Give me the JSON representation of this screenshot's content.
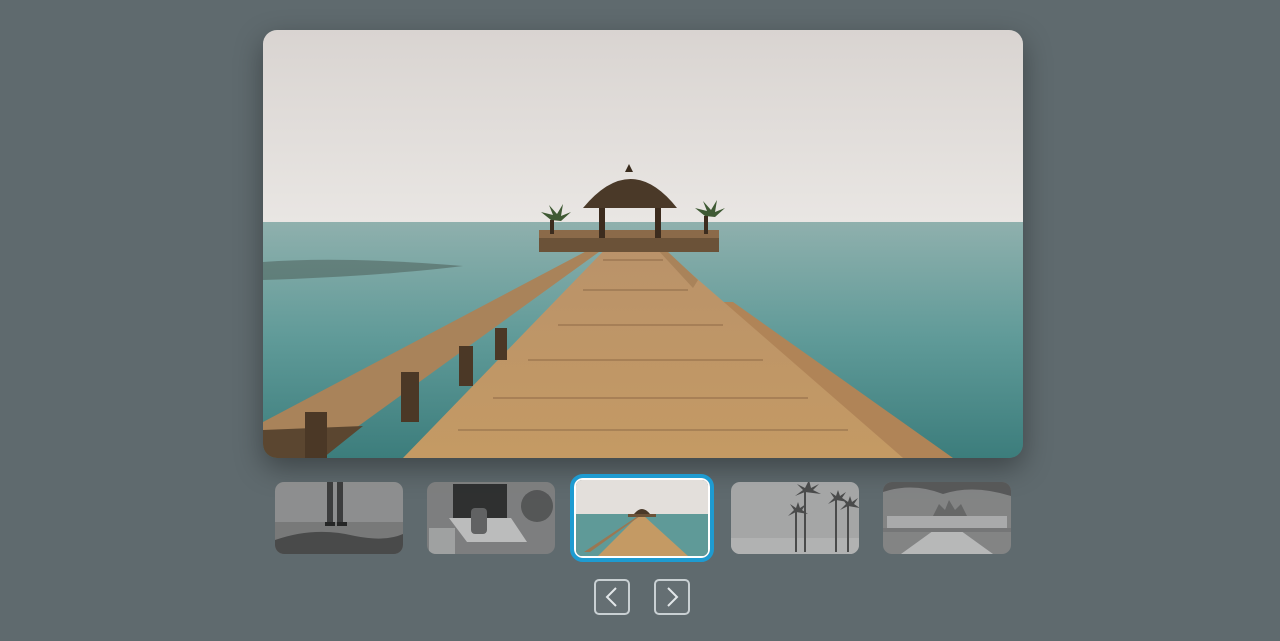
{
  "gallery": {
    "main_image": {
      "subject": "wooden-pier-hut-ocean"
    },
    "thumbnails": [
      {
        "subject": "person-standing-on-rocks",
        "active": false
      },
      {
        "subject": "laptop-on-desk",
        "active": false
      },
      {
        "subject": "wooden-pier-hut-ocean",
        "active": true
      },
      {
        "subject": "palm-trees-beach",
        "active": false
      },
      {
        "subject": "palace-road",
        "active": false
      }
    ],
    "controls": {
      "prev_icon": "chevron-left-icon",
      "next_icon": "chevron-right-icon"
    }
  },
  "colors": {
    "background": "#5f6a6e",
    "active_border": "#1e9bd1",
    "button_border": "#c9d0d3"
  }
}
